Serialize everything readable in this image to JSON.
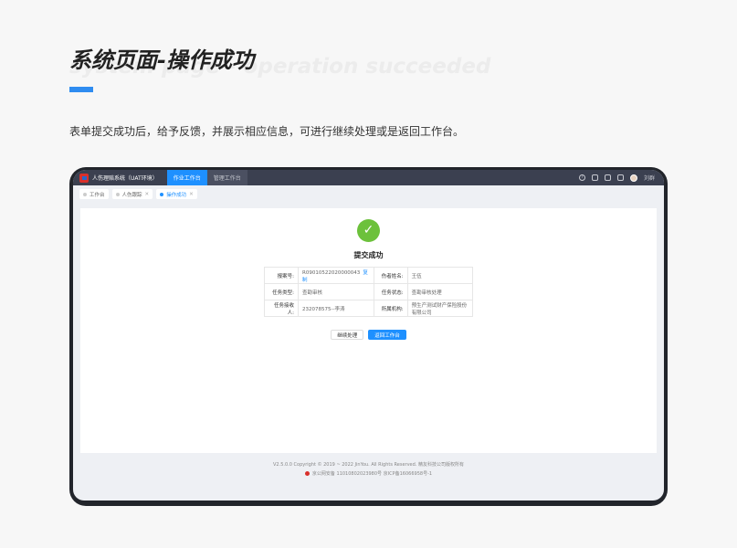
{
  "header": {
    "title": "系统页面-操作成功",
    "watermark": "system page - operation succeeded",
    "description": "表单提交成功后，给予反馈，并展示相应信息，可进行继续处理或是返回工作台。"
  },
  "app": {
    "name": "人伤理赔系统（UAT环境）",
    "nav": [
      "作业工作台",
      "管理工作台"
    ],
    "user": "刘群",
    "icons": [
      "help-icon",
      "home-icon",
      "book-icon",
      "message-icon"
    ],
    "tabs": [
      {
        "label": "工作台",
        "active": false
      },
      {
        "label": "人伤跟踪",
        "active": false
      },
      {
        "label": "操作成功",
        "active": true
      }
    ],
    "status_title": "提交成功",
    "info": [
      {
        "label": "报案号:",
        "value": "R09010522020000043",
        "link": "复制",
        "label2": "伤者姓名:",
        "value2": "王伍"
      },
      {
        "label": "任务类型:",
        "value": "查勘审核",
        "label2": "任务状态:",
        "value2": "查勘审核处理"
      },
      {
        "label": "任务接收人:",
        "value": "232078575--李涛",
        "label2": "所属机构:",
        "value2": "预生产测试财产保险股份有限公司"
      }
    ],
    "buttons": {
      "continue": "继续处理",
      "back": "返回工作台"
    },
    "footer": {
      "copyright": "V2.5.0.0 Copyright © 2019 ~ 2022 JinYou. All Rights Reserved. 精友科技公司版权所有",
      "icp": "京公网安备 11010802023980号 京ICP备16066958号-1"
    }
  },
  "colors": {
    "accent": "#1e90ff",
    "success": "#6cc13b",
    "topbar": "#3b4050"
  }
}
